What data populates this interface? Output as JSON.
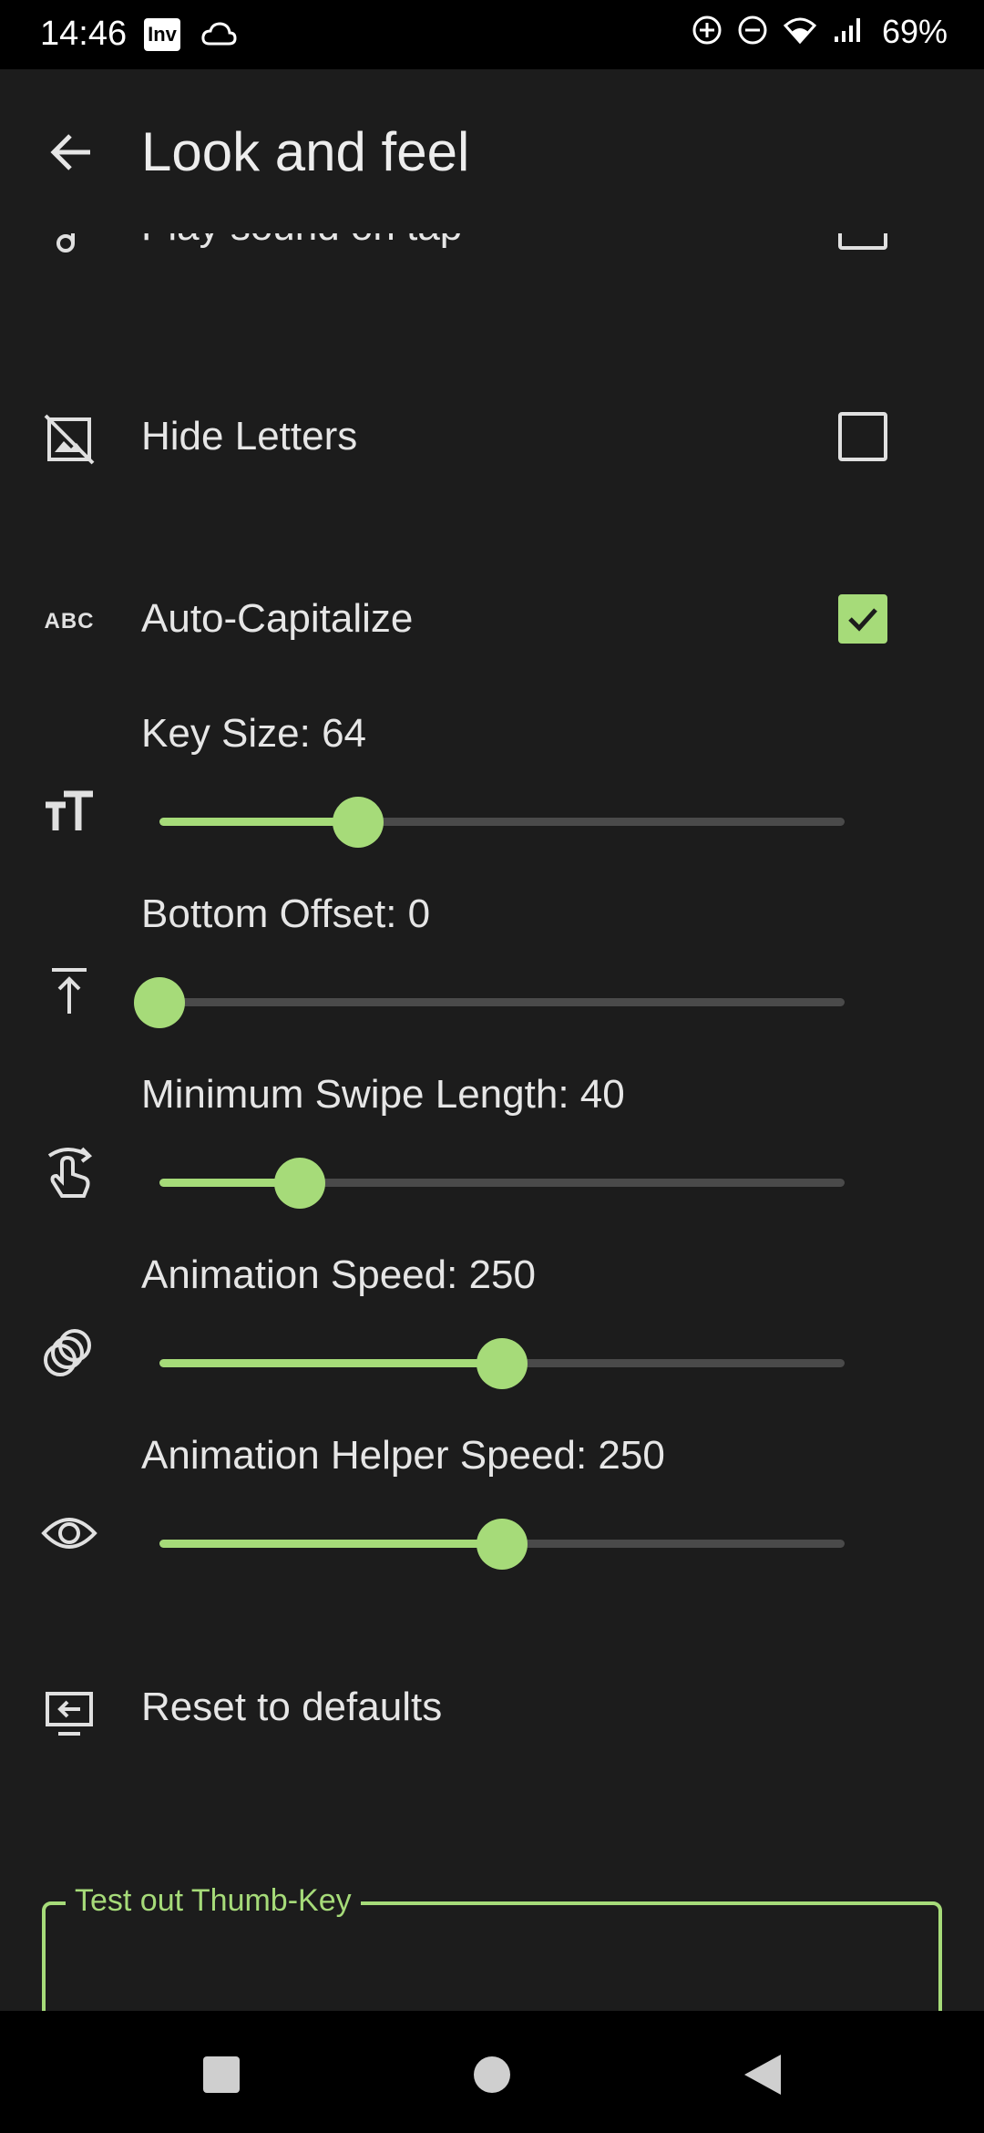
{
  "status_bar": {
    "time": "14:46",
    "inv_icon_text": "Inv",
    "battery": "69%"
  },
  "app_bar": {
    "title": "Look and feel",
    "back_icon": "arrow-back-icon"
  },
  "rows": {
    "play_sound": {
      "label": "Play sound on tap",
      "checked": false,
      "icon": "music-note-icon"
    },
    "hide_letters": {
      "label": "Hide Letters",
      "checked": false,
      "icon": "hide-image-icon"
    },
    "auto_capitalize": {
      "label": "Auto-Capitalize",
      "checked": true,
      "icon": "abc-icon"
    },
    "reset": {
      "label": "Reset to defaults",
      "icon": "reset-screen-icon"
    }
  },
  "sliders": {
    "key_size": {
      "label": "Key Size: 64",
      "fraction": 0.29,
      "icon": "text-size-icon"
    },
    "bottom_offset": {
      "label": "Bottom Offset: 0",
      "fraction": 0.0,
      "icon": "vertical-align-top-icon"
    },
    "min_swipe": {
      "label": "Minimum Swipe Length: 40",
      "fraction": 0.205,
      "icon": "swipe-icon"
    },
    "anim_speed": {
      "label": "Animation Speed: 250",
      "fraction": 0.5,
      "icon": "animation-icon"
    },
    "anim_helper_speed": {
      "label": "Animation Helper Speed: 250",
      "fraction": 0.5,
      "icon": "eye-icon"
    }
  },
  "test_field": {
    "label": "Test out Thumb-Key",
    "value": ""
  },
  "colors": {
    "accent": "#a6db79",
    "background": "#1c1c1c",
    "track": "#4a4a4a"
  },
  "nav": {
    "recents": "square-icon",
    "home": "circle-icon",
    "back": "triangle-back-icon"
  }
}
